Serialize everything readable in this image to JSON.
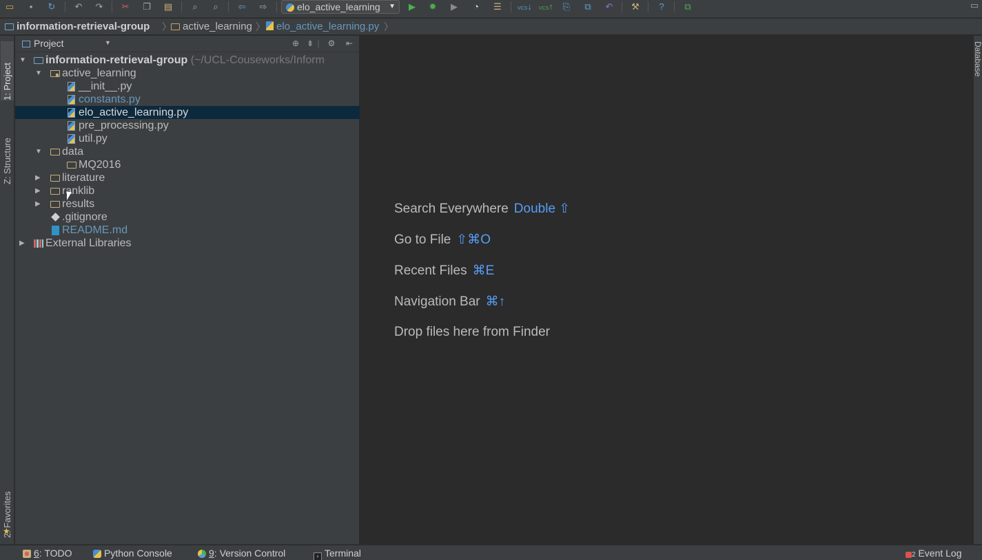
{
  "toolbar": {
    "run_config_label": "elo_active_learning",
    "icons": [
      "open-icon",
      "save-icon",
      "sync-icon",
      "undo-icon",
      "redo-icon",
      "cut-icon",
      "copy-icon",
      "paste-icon",
      "find-icon",
      "replace-icon",
      "back-icon",
      "forward-icon",
      "run-icon",
      "debug-icon",
      "coverage-icon",
      "profile-icon",
      "run-tasks-icon",
      "vcs-update-icon",
      "vcs-commit-icon",
      "vcs-diff-icon",
      "vcs-history-icon",
      "vcs-revert-icon",
      "settings-icon",
      "help-icon",
      "python-console-icon"
    ],
    "vcs_label": "VCS"
  },
  "breadcrumb": {
    "items": [
      "information-retrieval-group",
      "active_learning",
      "elo_active_learning.py"
    ]
  },
  "left_tabs": {
    "project": "1: Project",
    "structure": "Z: Structure",
    "favorites": "2: Favorites"
  },
  "right_tabs": {
    "database": "Database"
  },
  "project_panel": {
    "title": "Project",
    "tree": [
      {
        "label": "information-retrieval-group",
        "suffix": "(~/UCL-Couseworks/Inform",
        "icon": "project-folder-icon"
      },
      {
        "label": "active_learning",
        "icon": "package-folder-icon"
      },
      {
        "label": "__init__.py",
        "icon": "python-file-icon"
      },
      {
        "label": "constants.py",
        "icon": "python-file-icon"
      },
      {
        "label": "elo_active_learning.py",
        "icon": "python-file-icon"
      },
      {
        "label": "pre_processing.py",
        "icon": "python-file-icon"
      },
      {
        "label": "util.py",
        "icon": "python-file-icon"
      },
      {
        "label": "data",
        "icon": "folder-icon"
      },
      {
        "label": "MQ2016",
        "icon": "folder-icon"
      },
      {
        "label": "literature",
        "icon": "folder-icon"
      },
      {
        "label": "ranklib",
        "icon": "folder-icon"
      },
      {
        "label": "results",
        "icon": "folder-icon"
      },
      {
        "label": ".gitignore",
        "icon": "git-file-icon"
      },
      {
        "label": "README.md",
        "icon": "markdown-file-icon"
      },
      {
        "label": "External Libraries",
        "icon": "libraries-icon"
      }
    ]
  },
  "editor_hints": [
    {
      "text": "Search Everywhere",
      "shortcut": "Double ⇧"
    },
    {
      "text": "Go to File",
      "shortcut": "⇧⌘O"
    },
    {
      "text": "Recent Files",
      "shortcut": "⌘E"
    },
    {
      "text": "Navigation Bar",
      "shortcut": "⌘↑"
    },
    {
      "text": "Drop files here from Finder",
      "shortcut": ""
    }
  ],
  "statusbar": {
    "todo_num": "6",
    "todo_label": ": TODO",
    "python_console": "Python Console",
    "vc_num": "9",
    "vc_label": ": Version Control",
    "terminal": "Terminal",
    "event_log_count": "2",
    "event_log": "Event Log"
  },
  "colors": {
    "background": "#2b2b2b",
    "panel": "#3c3f41",
    "selection": "#0d293e",
    "accent_blue": "#589df6",
    "vcs_changed": "#6897bb"
  }
}
